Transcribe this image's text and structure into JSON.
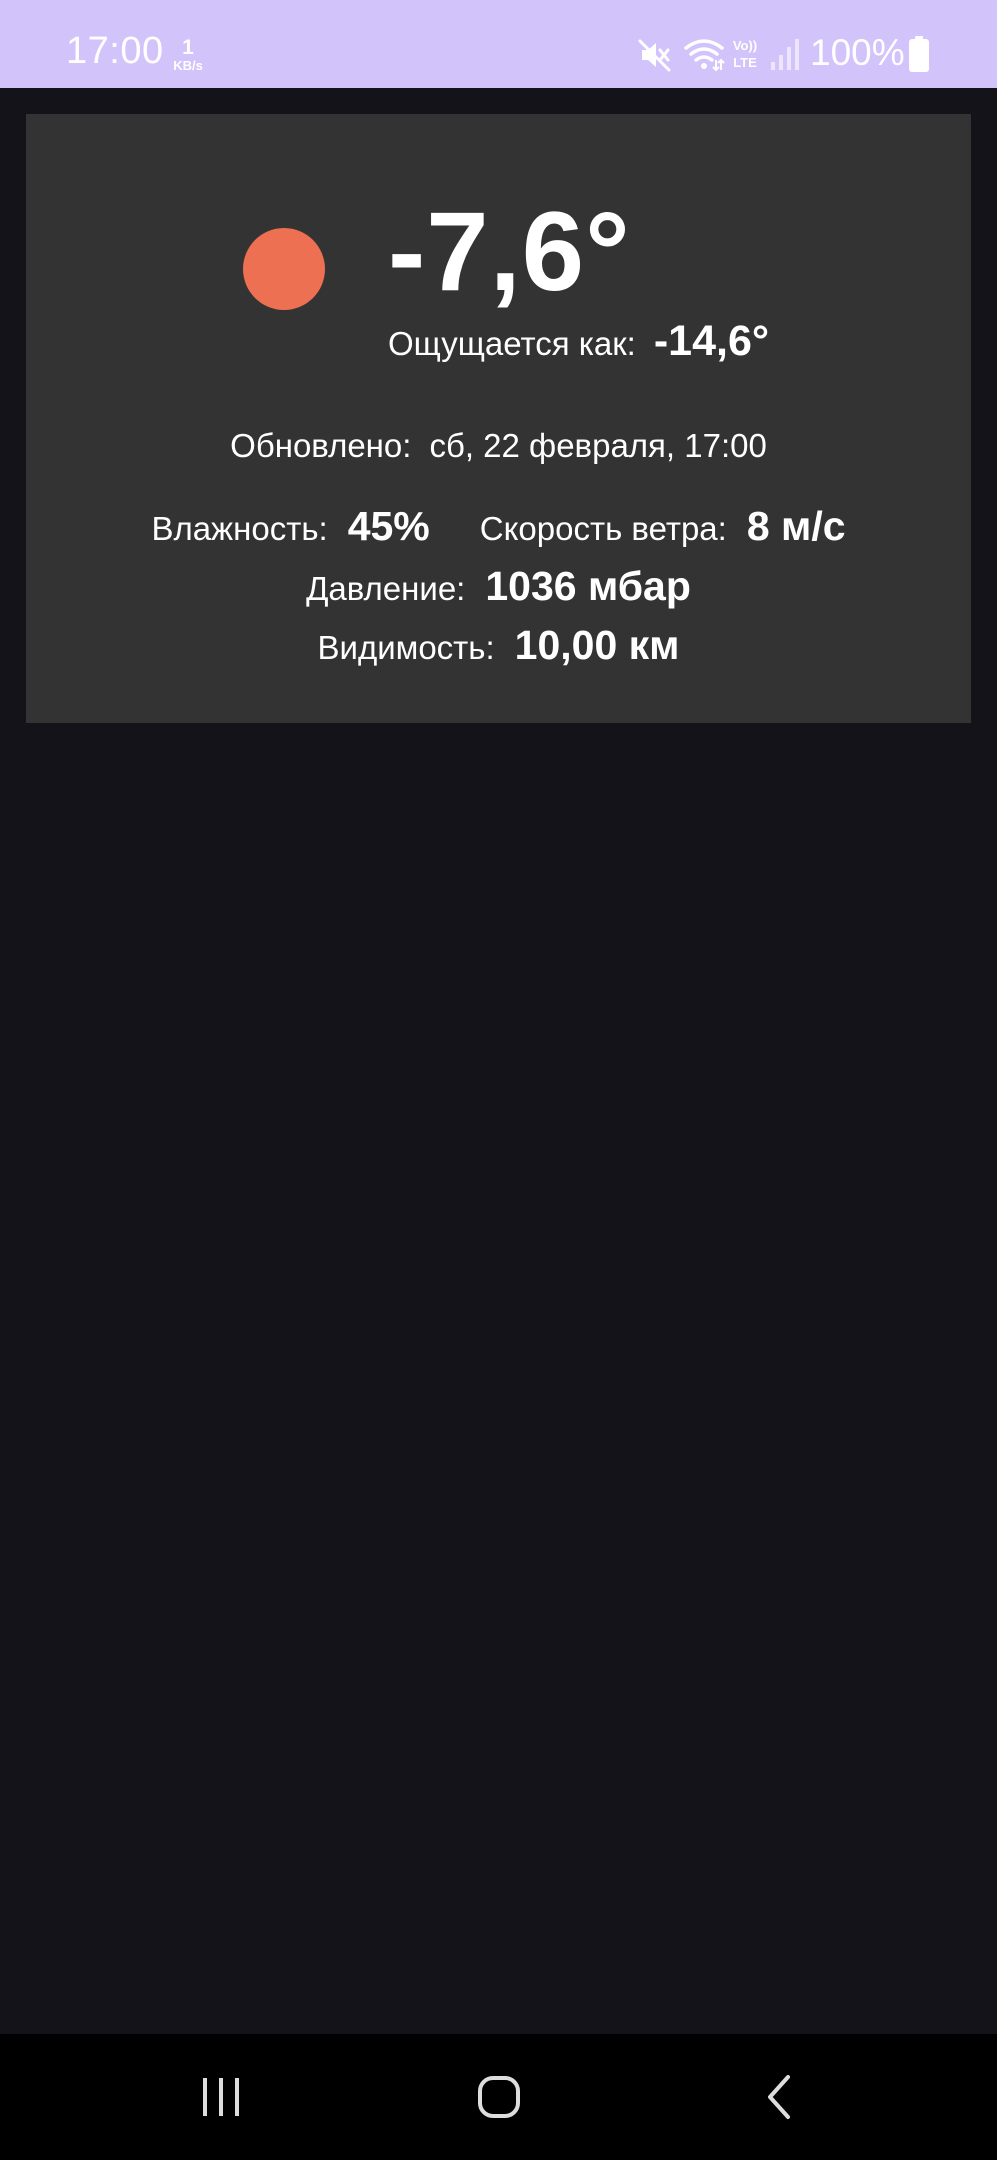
{
  "status_bar": {
    "time": "17:00",
    "speed_value": "1",
    "speed_unit": "KB/s",
    "battery_percent": "100%",
    "icons": [
      "mute-icon",
      "wifi-icon",
      "volte-icon",
      "signal-icon",
      "battery-icon"
    ],
    "background_color": "#d3c3fb"
  },
  "weather": {
    "temperature": "-7,6°",
    "feels_like_label": "Ощущается как:",
    "feels_like_value": "-14,6°",
    "updated_label": "Обновлено:",
    "updated_value": "сб, 22 февраля, 17:00",
    "humidity_label": "Влажность:",
    "humidity_value": "45%",
    "wind_label": "Скорость ветра:",
    "wind_value": "8 м/с",
    "pressure_label": "Давление:",
    "pressure_value": "1036 мбар",
    "visibility_label": "Видимость:",
    "visibility_value": "10,00 км",
    "icon": "sun-icon",
    "icon_color": "#ee7052",
    "card_color": "#333333"
  },
  "nav_bar": {
    "buttons": [
      "recent-apps-icon",
      "home-icon",
      "back-icon"
    ]
  }
}
